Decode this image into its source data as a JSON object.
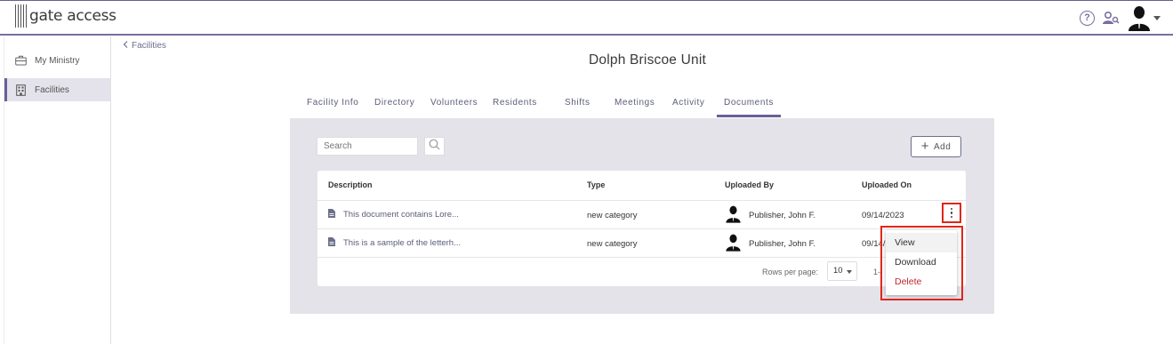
{
  "app": {
    "logo_text": "gate access"
  },
  "header": {
    "help_icon": "help-circle-icon",
    "users_icon": "user-search-icon",
    "avatar_icon": "avatar-silhouette-icon"
  },
  "sidebar": {
    "items": [
      {
        "label": "My Ministry",
        "icon": "briefcase-icon",
        "active": false
      },
      {
        "label": "Facilities",
        "icon": "building-icon",
        "active": true
      }
    ]
  },
  "breadcrumb": {
    "back_label": "Facilities"
  },
  "page": {
    "title": "Dolph Briscoe Unit"
  },
  "tabs": [
    {
      "label": "Facility Info"
    },
    {
      "label": "Directory"
    },
    {
      "label": "Volunteers"
    },
    {
      "label": "Residents"
    },
    {
      "label": "Shifts"
    },
    {
      "label": "Meetings"
    },
    {
      "label": "Activity"
    },
    {
      "label": "Documents",
      "active": true
    }
  ],
  "toolbar": {
    "search_placeholder": "Search",
    "add_label": "Add"
  },
  "table": {
    "columns": [
      "Description",
      "Type",
      "Uploaded By",
      "Uploaded On"
    ],
    "rows": [
      {
        "description": "This document contains Lore...",
        "type": "new category",
        "uploaded_by": "Publisher, John F.",
        "uploaded_on": "09/14/2023"
      },
      {
        "description": "This is a sample of the letterh...",
        "type": "new category",
        "uploaded_by": "Publisher, John F.",
        "uploaded_on": "09/14/"
      }
    ],
    "footer": {
      "rows_per_page_label": "Rows per page:",
      "rows_per_page_value": "10",
      "range_text": "1-"
    }
  },
  "context_menu": {
    "items": [
      "View",
      "Download",
      "Delete"
    ]
  },
  "colors": {
    "accent": "#6b5f9a",
    "highlight": "#e0261a",
    "danger": "#c0272d"
  }
}
